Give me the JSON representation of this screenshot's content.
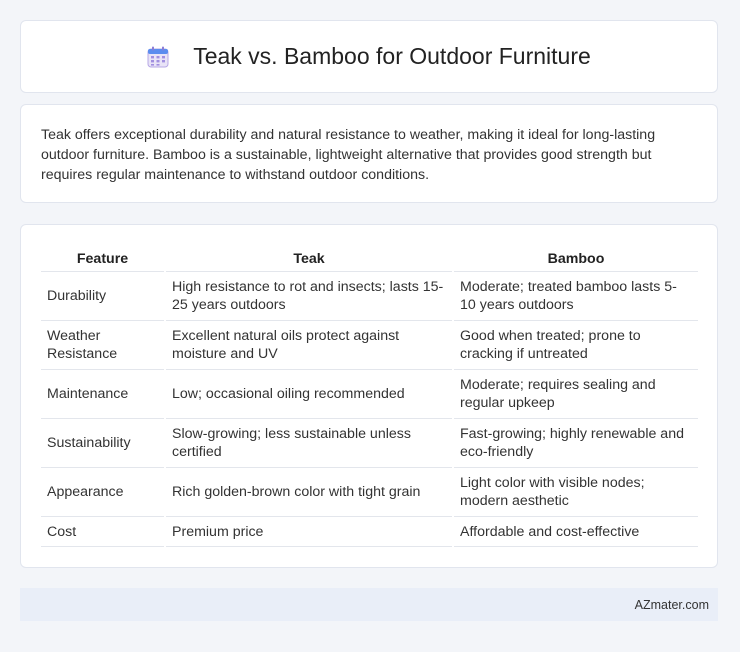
{
  "header": {
    "title": "Teak vs. Bamboo for Outdoor Furniture",
    "icon": "calendar-icon"
  },
  "intro": {
    "text": "Teak offers exceptional durability and natural resistance to weather, making it ideal for long-lasting outdoor furniture. Bamboo is a sustainable, lightweight alternative that provides good strength but requires regular maintenance to withstand outdoor conditions."
  },
  "table": {
    "headers": [
      "Feature",
      "Teak",
      "Bamboo"
    ],
    "rows": [
      [
        "Durability",
        "High resistance to rot and insects; lasts 15-25 years outdoors",
        "Moderate; treated bamboo lasts 5-10 years outdoors"
      ],
      [
        "Weather Resistance",
        "Excellent natural oils protect against moisture and UV",
        "Good when treated; prone to cracking if untreated"
      ],
      [
        "Maintenance",
        "Low; occasional oiling recommended",
        "Moderate; requires sealing and regular upkeep"
      ],
      [
        "Sustainability",
        "Slow-growing; less sustainable unless certified",
        "Fast-growing; highly renewable and eco-friendly"
      ],
      [
        "Appearance",
        "Rich golden-brown color with tight grain",
        "Light color with visible nodes; modern aesthetic"
      ],
      [
        "Cost",
        "Premium price",
        "Affordable and cost-effective"
      ]
    ]
  },
  "footer": {
    "brand": "AZmater.com"
  }
}
